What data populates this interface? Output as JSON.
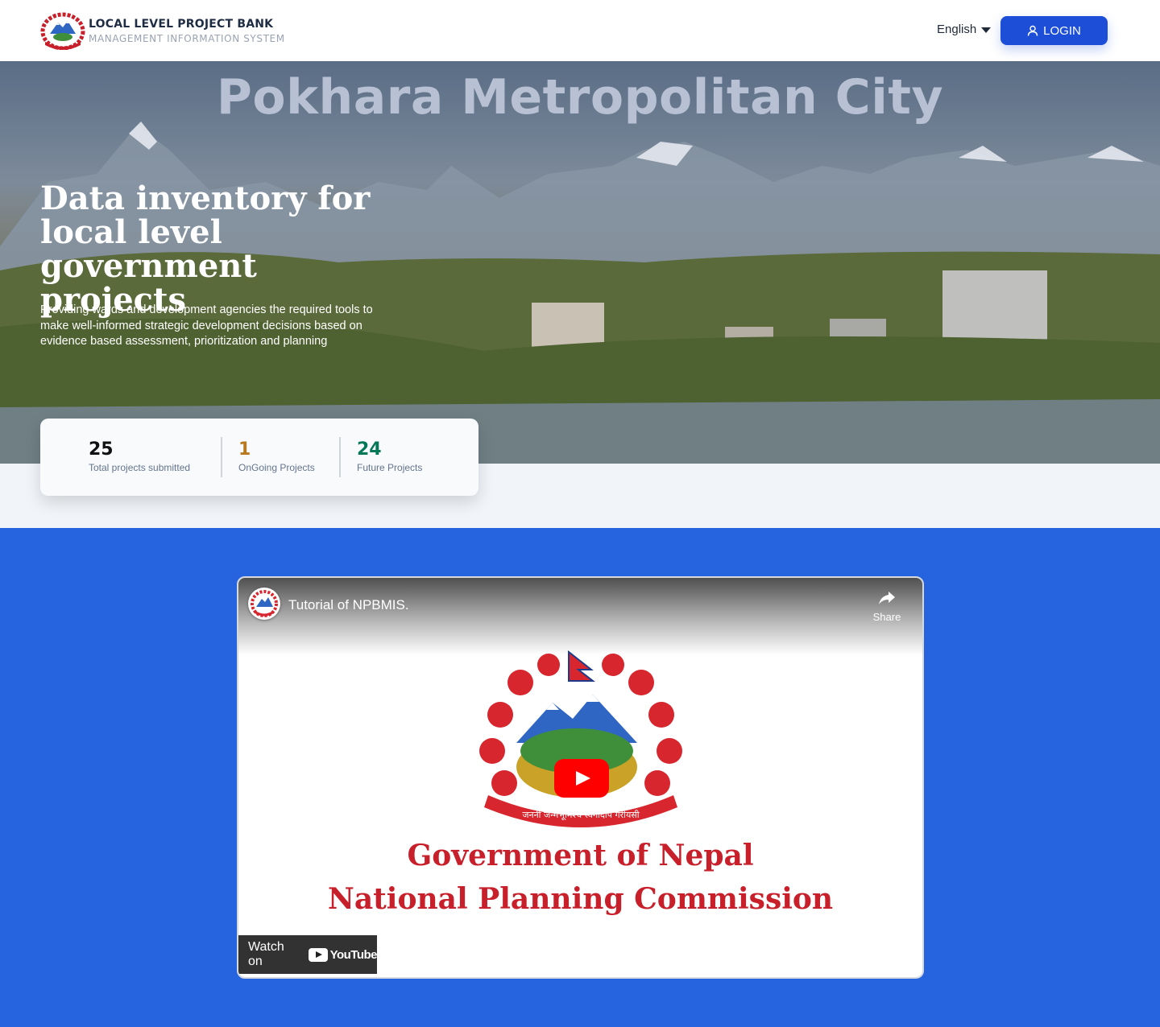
{
  "header": {
    "title": "LOCAL LEVEL PROJECT BANK",
    "subtitle": "MANAGEMENT INFORMATION SYSTEM",
    "language": "English",
    "login_label": "LOGIN"
  },
  "hero": {
    "city": "Pokhara Metropolitan City",
    "heading": "Data inventory for local level government projects",
    "description": "Providing wards and development agencies the required tools to make well-informed strategic development decisions based on evidence based assessment, prioritization and planning"
  },
  "stats": [
    {
      "value": "25",
      "label": "Total projects submitted",
      "color": "#111111"
    },
    {
      "value": "1",
      "label": "OnGoing Projects",
      "color": "#b7791f"
    },
    {
      "value": "24",
      "label": "Future Projects",
      "color": "#047857"
    }
  ],
  "video": {
    "title": "Tutorial of NPBMIS.",
    "share_label": "Share",
    "line1": "Government of Nepal",
    "line2": "National Planning Commission",
    "watch_label": "Watch on",
    "youtube_label": "YouTube",
    "emblem_motto": "जननी जन्मभूमिश्च स्वर्गादपि गरीयसी"
  },
  "colors": {
    "brand_blue": "#1d4ed8",
    "section_blue": "#2563df",
    "emblem_red": "#c8202b"
  },
  "icons": {
    "login": "user-icon",
    "language": "caret-down-icon",
    "share": "share-arrow-icon",
    "play": "youtube-play-icon"
  }
}
